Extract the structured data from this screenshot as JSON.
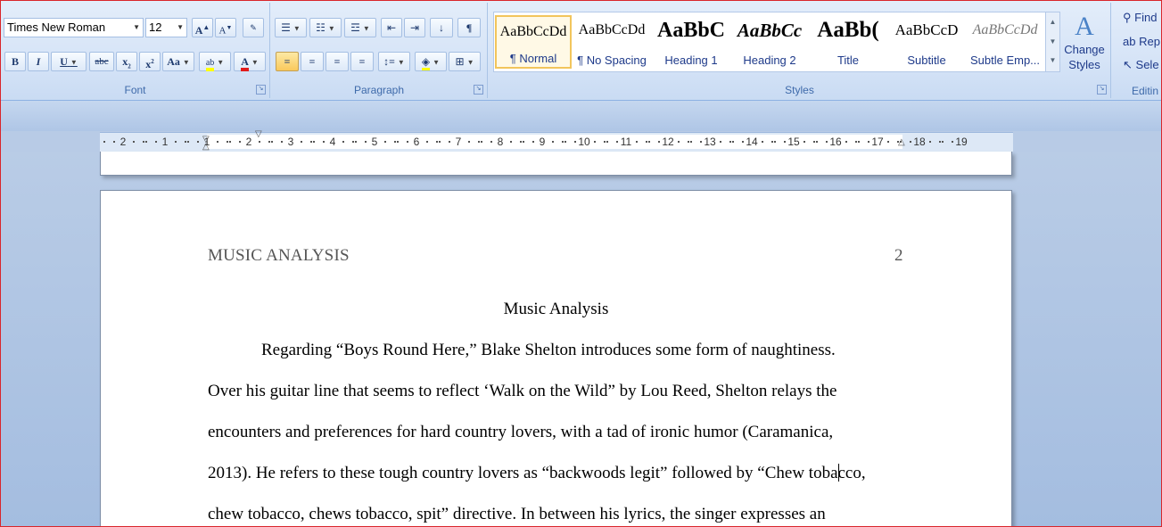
{
  "font_group": {
    "label": "Font",
    "font_name": "Times New Roman",
    "font_size": "12",
    "buttons": {
      "grow": "A",
      "shrink": "A",
      "bold": "B",
      "italic": "I",
      "underline": "U",
      "strike": "abc",
      "subscript": "x",
      "superscript": "x",
      "change_case": "Aa",
      "font_color": "A"
    }
  },
  "paragraph_group": {
    "label": "Paragraph",
    "pilcrow": "¶"
  },
  "styles_group": {
    "label": "Styles",
    "tiles": [
      {
        "sample": "AaBbCcDd",
        "name": "¶ Normal"
      },
      {
        "sample": "AaBbCcDd",
        "name": "¶ No Spacing"
      },
      {
        "sample": "AaBbC",
        "name": "Heading 1"
      },
      {
        "sample": "AaBbCc",
        "name": "Heading 2"
      },
      {
        "sample": "AaBb(",
        "name": "Title"
      },
      {
        "sample": "AaBbCcD",
        "name": "Subtitle"
      },
      {
        "sample": "AaBbCcDd",
        "name": "Subtle Emp..."
      }
    ],
    "change_styles": "Change Styles"
  },
  "editing_group": {
    "label": "Editin",
    "items": [
      "Find",
      "Rep",
      "Sele"
    ]
  },
  "ruler": {
    "labels": [
      "2",
      "1",
      "1",
      "2",
      "3",
      "4",
      "5",
      "6",
      "7",
      "8",
      "9",
      "10",
      "11",
      "12",
      "13",
      "14",
      "15",
      "16",
      "17",
      "18",
      "19"
    ]
  },
  "document": {
    "running_head": "MUSIC ANALYSIS",
    "page_number": "2",
    "title": "Music Analysis",
    "lines": [
      "Regarding “Boys Round Here,” Blake Shelton introduces some form of naughtiness.",
      "Over his guitar line that seems to reflect ‘Walk on the Wild” by Lou Reed, Shelton relays the",
      "encounters and preferences for hard country lovers, with a tad of ironic humor (Caramanica,",
      "2013). He refers to these tough country lovers as “backwoods legit” followed by “Chew tobacco,",
      "chew tobacco, chews tobacco, spit” directive. In between his lyrics, the singer expresses an"
    ]
  },
  "colors": {
    "ribbon_bg": "#dbe7f7",
    "accent_border": "#f2c55c",
    "highlight_yellow": "#ffff00",
    "font_color_red": "#e11b1b",
    "frame_border": "#d9262b"
  }
}
